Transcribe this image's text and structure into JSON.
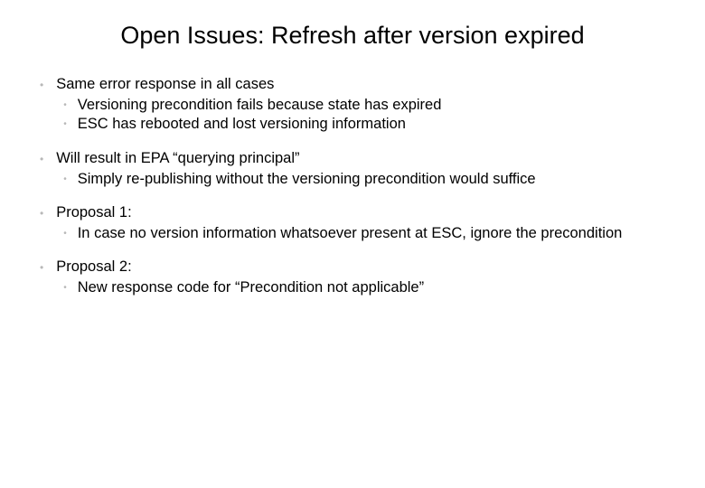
{
  "title": "Open Issues: Refresh after version expired",
  "bullets": [
    {
      "text": "Same error response in all cases",
      "subs": [
        "Versioning precondition fails because state has expired",
        "ESC has rebooted and lost versioning information"
      ]
    },
    {
      "text": "Will result in EPA “querying principal”",
      "subs": [
        "Simply re-publishing without the versioning precondition would suffice"
      ]
    },
    {
      "text": "Proposal 1:",
      "subs": [
        "In case no version information whatsoever present at ESC, ignore the precondition"
      ]
    },
    {
      "text": "Proposal 2:",
      "subs": [
        "New response code for “Precondition not applicable”"
      ]
    }
  ]
}
